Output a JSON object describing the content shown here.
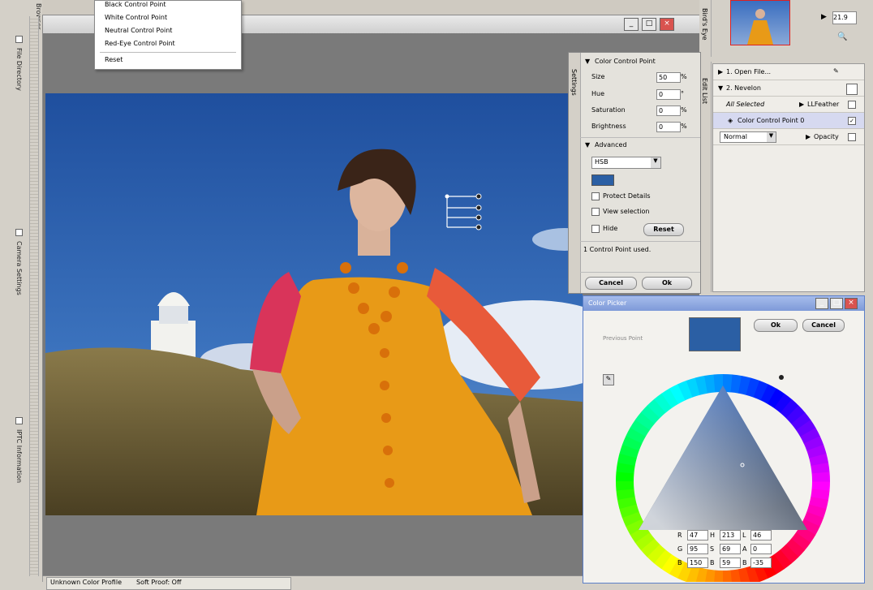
{
  "menu": {
    "items": [
      "Black Control Point",
      "White Control Point",
      "Neutral Control Point",
      "Red-Eye Control Point"
    ],
    "reset": "Reset"
  },
  "left_tabs": [
    "File Directory",
    "Camera Settings",
    "IPTC Information"
  ],
  "left_header": "Browser",
  "settings_panel": {
    "side_label": "Settings",
    "title": "Color Control Point",
    "fields": [
      {
        "label": "Size",
        "value": "50",
        "unit": "%"
      },
      {
        "label": "Hue",
        "value": "0",
        "unit": "°"
      },
      {
        "label": "Saturation",
        "value": "0",
        "unit": "%"
      },
      {
        "label": "Brightness",
        "value": "0",
        "unit": "%"
      }
    ],
    "advanced": "Advanced",
    "mode": "HSB",
    "swatch_color": "#2b5fa4",
    "protect_details": "Protect Details",
    "view_selection": "View selection",
    "hide": "Hide",
    "reset": "Reset",
    "status": "1 Control Point used.",
    "cancel": "Cancel",
    "ok": "Ok"
  },
  "bird_eye": {
    "label": "Bird's Eye",
    "zoom": "21.9"
  },
  "edit_list": {
    "side_label": "Edit List",
    "rows": [
      {
        "text": "1. Open File..."
      },
      {
        "text": "2. Nevelon"
      },
      {
        "text": "All Selected",
        "right": "LLFeather"
      },
      {
        "text": "Color Control Point 0"
      },
      {
        "text": "Normal",
        "right": "Opacity"
      }
    ]
  },
  "picker": {
    "title": "Color Picker",
    "previous": "Previous Point",
    "ok": "Ok",
    "cancel": "Cancel",
    "swatch_color": "#2b5fa4",
    "values": {
      "R": "47",
      "H": "213",
      "L": "46",
      "G": "95",
      "S": "69",
      "A": "0",
      "B": "150",
      "Bv": "59",
      "Bl": "-35"
    }
  },
  "status_bar": {
    "left": "Unknown Color Profile",
    "right": "Soft Proof: Off"
  }
}
